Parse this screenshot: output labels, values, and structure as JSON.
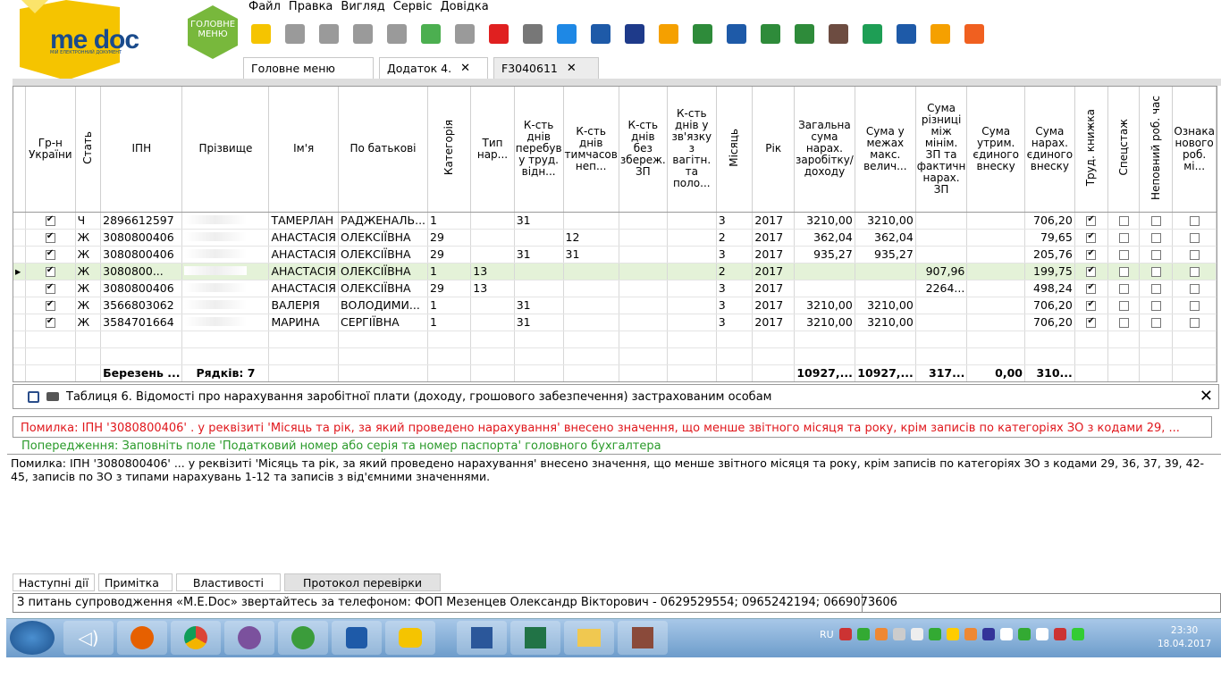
{
  "app": {
    "logo_text": "me doc",
    "logo_sub": "МІЙ ЕЛЕКТРОННИЙ ДОКУМЕНТ",
    "main_menu": "ГОЛОВНЕ МЕНЮ"
  },
  "menu": [
    "Файл",
    "Правка",
    "Вигляд",
    "Сервіс",
    "Довідка"
  ],
  "toolbar": [
    "new-doc-icon",
    "open-doc-icon",
    "delete-doc-icon",
    "copy-icon",
    "paste-icon",
    "add-row-icon",
    "edit-row-icon",
    "delete-row-icon",
    "sort-za-icon",
    "share-icon",
    "save-icon",
    "print-icon",
    "send-mail-icon",
    "find-icon",
    "zoom-icon",
    "check-icon",
    "refresh-icon",
    "calculator-icon",
    "message-icon",
    "calendar-icon",
    "help-icon",
    "chat-icon"
  ],
  "tabs": [
    {
      "label": "Головне меню",
      "closable": false
    },
    {
      "label": "Додаток 4.",
      "closable": true
    },
    {
      "label": "F3040611",
      "closable": true
    }
  ],
  "grid": {
    "headers": [
      "Гр-н України",
      "Стать",
      "ІПН",
      "Прізвище",
      "Ім'я",
      "По батькові",
      "Категорія",
      "Тип нар...",
      "К-сть днів перебув у труд. відн...",
      "К-сть днів тимчасов неп...",
      "К-сть днів без збереж. ЗП",
      "К-сть днів у зв'язку з вагітн. та поло...",
      "Місяць",
      "Рік",
      "Загальна сума нарах. заробітку/ доходу",
      "Сума у межах макс. велич...",
      "Сума різниці між мінім. ЗП та фактичн нарах. ЗП",
      "Сума утрим. єдиного внеску",
      "Сума нарах. єдиного внеску",
      "Труд. книжка",
      "Спецстаж",
      "Неповний роб. час",
      "Ознака нового роб. мі..."
    ],
    "rows": [
      {
        "ua": true,
        "sex": "Ч",
        "ipn": "2896612597",
        "surname": "",
        "name": "ТАМЕРЛАН",
        "patr": "РАДЖЕНАЛЬ...",
        "cat": "1",
        "type": "",
        "d1": "31",
        "d2": "",
        "d3": "",
        "d4": "",
        "month": "3",
        "year": "2017",
        "total": "3210,00",
        "max": "3210,00",
        "diff": "",
        "held": "",
        "accr": "706,20",
        "book": true,
        "spec": false,
        "part": false,
        "newj": false,
        "selected": false
      },
      {
        "ua": true,
        "sex": "Ж",
        "ipn": "3080800406",
        "surname": "",
        "name": "АНАСТАСІЯ",
        "patr": "ОЛЕКСІЇВНА",
        "cat": "29",
        "type": "",
        "d1": "",
        "d2": "12",
        "d3": "",
        "d4": "",
        "month": "2",
        "year": "2017",
        "total": "362,04",
        "max": "362,04",
        "diff": "",
        "held": "",
        "accr": "79,65",
        "book": true,
        "spec": false,
        "part": false,
        "newj": false,
        "selected": false
      },
      {
        "ua": true,
        "sex": "Ж",
        "ipn": "3080800406",
        "surname": "",
        "name": "АНАСТАСІЯ",
        "patr": "ОЛЕКСІЇВНА",
        "cat": "29",
        "type": "",
        "d1": "31",
        "d2": "31",
        "d3": "",
        "d4": "",
        "month": "3",
        "year": "2017",
        "total": "935,27",
        "max": "935,27",
        "diff": "",
        "held": "",
        "accr": "205,76",
        "book": true,
        "spec": false,
        "part": false,
        "newj": false,
        "selected": false
      },
      {
        "ua": true,
        "sex": "Ж",
        "ipn": "3080800...",
        "surname": "",
        "name": "АНАСТАСІЯ",
        "patr": "ОЛЕКСІЇВНА",
        "cat": "1",
        "type": "13",
        "d1": "",
        "d2": "",
        "d3": "",
        "d4": "",
        "month": "2",
        "year": "2017",
        "total": "",
        "max": "",
        "diff": "907,96",
        "held": "",
        "accr": "199,75",
        "book": true,
        "spec": false,
        "part": false,
        "newj": false,
        "selected": true
      },
      {
        "ua": true,
        "sex": "Ж",
        "ipn": "3080800406",
        "surname": "",
        "name": "АНАСТАСІЯ",
        "patr": "ОЛЕКСІЇВНА",
        "cat": "29",
        "type": "13",
        "d1": "",
        "d2": "",
        "d3": "",
        "d4": "",
        "month": "3",
        "year": "2017",
        "total": "",
        "max": "",
        "diff": "2264...",
        "held": "",
        "accr": "498,24",
        "book": true,
        "spec": false,
        "part": false,
        "newj": false,
        "selected": false
      },
      {
        "ua": true,
        "sex": "Ж",
        "ipn": "3566803062",
        "surname": "",
        "name": "ВАЛЕРІЯ",
        "patr": "ВОЛОДИМИ...",
        "cat": "1",
        "type": "",
        "d1": "31",
        "d2": "",
        "d3": "",
        "d4": "",
        "month": "3",
        "year": "2017",
        "total": "3210,00",
        "max": "3210,00",
        "diff": "",
        "held": "",
        "accr": "706,20",
        "book": true,
        "spec": false,
        "part": false,
        "newj": false,
        "selected": false
      },
      {
        "ua": true,
        "sex": "Ж",
        "ipn": "3584701664",
        "surname": "",
        "name": "МАРИНА",
        "patr": "СЕРГІЇВНА",
        "cat": "1",
        "type": "",
        "d1": "31",
        "d2": "",
        "d3": "",
        "d4": "",
        "month": "3",
        "year": "2017",
        "total": "3210,00",
        "max": "3210,00",
        "diff": "",
        "held": "",
        "accr": "706,20",
        "book": true,
        "spec": false,
        "part": false,
        "newj": false,
        "selected": false
      }
    ],
    "totals": {
      "month": "Березень ...",
      "rows": "Рядків: 7",
      "total": "10927,...",
      "max": "10927,...",
      "diff": "317...",
      "held": "0,00",
      "accr": "310..."
    }
  },
  "table_title": "Таблиця 6. Відомості про нарахування заробітної плати (доходу, грошового забезпечення) застрахованим особам",
  "error_line": "Помилка: ІПН '3080800406' .                       у реквізиті 'Місяць та рік, за який проведено нарахування' внесено значення, що менше звітного місяця та року,  крім записів по категоріях ЗО з кодами 29, ...",
  "warning_line": "Попередження: Заповніть поле 'Податковий номер або серія та номер паспорта' головного бухгалтера",
  "detail_text": "Помилка: ІПН '3080800406' ...            у реквізиті 'Місяць та рік, за який проведено нарахування' внесено значення, що менше звітного місяця та року,  крім записів по категоріях ЗО з кодами 29, 36, 37, 39, 42-45, записів по ЗО з типами нарахувань 1-12 та записів з від'ємними значеннями.",
  "bottom_tabs": [
    "Наступні дії",
    "Примітка",
    "Властивості",
    "Протокол перевірки"
  ],
  "status": "З питань супроводження «M.E.Doc» звертайтесь за телефоном: ФОП Мезенцев Олександр Вікторович - 0629529554; 0965242194; 0669073606",
  "taskbar": {
    "lang": "RU",
    "time": "23:30",
    "date": "18.04.2017"
  },
  "colors": {
    "accent_yellow": "#f5c400",
    "accent_green": "#78b83c",
    "error": "#e0161b",
    "warning": "#2a9a2a",
    "selected_row": "#e4f2d8"
  }
}
